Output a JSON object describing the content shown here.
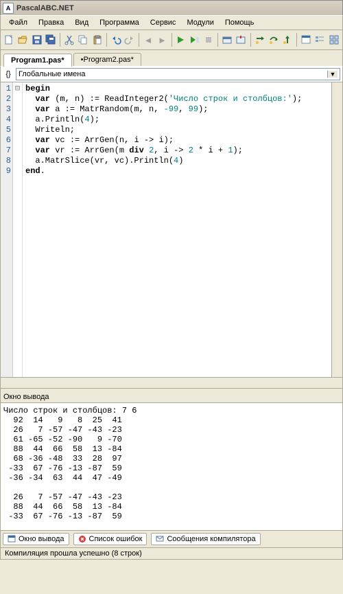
{
  "app": {
    "title": "PascalABC.NET"
  },
  "menu": {
    "items": [
      "Файл",
      "Правка",
      "Вид",
      "Программа",
      "Сервис",
      "Модули",
      "Помощь"
    ]
  },
  "tabs": {
    "items": [
      {
        "label": "Program1.pas*",
        "active": true
      },
      {
        "label": "•Program2.pas*",
        "active": false
      }
    ]
  },
  "combo": {
    "label": "Глобальные имена"
  },
  "code": {
    "lines": [
      {
        "n": "1",
        "fold": "⊟",
        "t": [
          {
            "k": "begin",
            "kw": true
          }
        ]
      },
      {
        "n": "2",
        "fold": "",
        "t": [
          {
            "k": "  "
          },
          {
            "k": "var ",
            "kw": true
          },
          {
            "k": "(m, n) := ReadInteger2("
          },
          {
            "k": "'Число строк и столбцов:'",
            "str": true
          },
          {
            "k": ");"
          }
        ]
      },
      {
        "n": "3",
        "fold": "",
        "t": [
          {
            "k": "  "
          },
          {
            "k": "var ",
            "kw": true
          },
          {
            "k": "a := MatrRandom(m, n, "
          },
          {
            "k": "-99",
            "num": true
          },
          {
            "k": ", "
          },
          {
            "k": "99",
            "num": true
          },
          {
            "k": ");"
          }
        ]
      },
      {
        "n": "4",
        "fold": "",
        "t": [
          {
            "k": "  a.Println("
          },
          {
            "k": "4",
            "num": true
          },
          {
            "k": ");"
          }
        ]
      },
      {
        "n": "5",
        "fold": "",
        "t": [
          {
            "k": "  Writeln;"
          }
        ]
      },
      {
        "n": "6",
        "fold": "",
        "t": [
          {
            "k": "  "
          },
          {
            "k": "var ",
            "kw": true
          },
          {
            "k": "vc := ArrGen(n, i -> i);"
          }
        ]
      },
      {
        "n": "7",
        "fold": "",
        "t": [
          {
            "k": "  "
          },
          {
            "k": "var ",
            "kw": true
          },
          {
            "k": "vr := ArrGen(m "
          },
          {
            "k": "div ",
            "kw": true
          },
          {
            "k": "2",
            "num": true
          },
          {
            "k": ", i -> "
          },
          {
            "k": "2",
            "num": true
          },
          {
            "k": " * i + "
          },
          {
            "k": "1",
            "num": true
          },
          {
            "k": ");"
          }
        ]
      },
      {
        "n": "8",
        "fold": "",
        "t": [
          {
            "k": "  a.MatrSlice(vr, vc).Println("
          },
          {
            "k": "4",
            "num": true
          },
          {
            "k": ")"
          }
        ]
      },
      {
        "n": "9",
        "fold": "",
        "t": [
          {
            "k": "end",
            "kw": true
          },
          {
            "k": "."
          }
        ]
      }
    ]
  },
  "output": {
    "title": "Окно вывода",
    "text": "Число строк и столбцов: 7 6\n  92  14   9   8  25  41\n  26   7 -57 -47 -43 -23\n  61 -65 -52 -90   9 -70\n  88  44  66  58  13 -84\n  68 -36 -48  33  28  97\n -33  67 -76 -13 -87  59\n -36 -34  63  44  47 -49\n\n  26   7 -57 -47 -43 -23\n  88  44  66  58  13 -84\n -33  67 -76 -13 -87  59"
  },
  "bottom_tabs": {
    "items": [
      {
        "label": "Окно вывода",
        "icon": "window"
      },
      {
        "label": "Список ошибок",
        "icon": "error"
      },
      {
        "label": "Сообщения компилятора",
        "icon": "message"
      }
    ]
  },
  "status": {
    "text": "Компиляция прошла успешно (8 строк)"
  }
}
